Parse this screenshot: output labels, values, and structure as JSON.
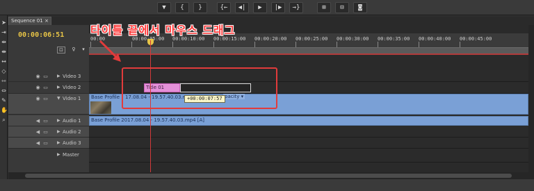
{
  "transport": {
    "buttons": [
      "▼",
      "{",
      "}",
      "{←",
      "◀|",
      "▶",
      "|▶",
      "→}",
      "⊞",
      "⊟",
      "◙"
    ]
  },
  "sequence_tab": {
    "label": "Sequence 01",
    "close": "×"
  },
  "timecode": "00:00:06:51",
  "ruler": {
    "labels": [
      "00:00",
      "00:00:05:00",
      "00:00:10:00",
      "00:00:15:00",
      "00:00:20:00",
      "00:00:25:00",
      "00:00:30:00",
      "00:00:35:00",
      "00:00:40:00",
      "00:00:45:00"
    ]
  },
  "tracks": {
    "video3": "Video 3",
    "video2": "Video 2",
    "video1": "Video 1",
    "audio1": "Audio 1",
    "audio2": "Audio 2",
    "audio3": "Audio 3",
    "master": "Master"
  },
  "clips": {
    "title_clip": "Title 01",
    "video1_a": "Base Profile",
    "video1_b": "17.08.04 - 19.57.40.03.mp4",
    "video1_opacity": "pacity ▾",
    "audio1": "Base Profile 2017.08.04 - 19.57.40.03.mp4 [A]"
  },
  "tooltip": "+00:00:07:57",
  "annotation": "타이틀 끝에서 마우스 드래그",
  "colors": {
    "accent_timecode": "#e8c547",
    "clip_blue": "#7aa0d6",
    "title_pink": "#e490d8",
    "annotation_red": "#e23b3b"
  }
}
